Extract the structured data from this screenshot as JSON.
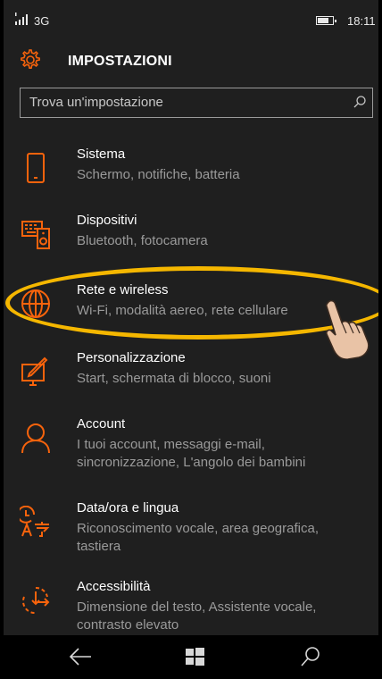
{
  "statusbar": {
    "network": "3G",
    "time": "18:11"
  },
  "header": {
    "title": "IMPOSTAZIONI"
  },
  "search": {
    "placeholder": "Trova un'impostazione"
  },
  "items": [
    {
      "name": "Sistema",
      "desc": "Schermo, notifiche, batteria",
      "icon": "phone-icon"
    },
    {
      "name": "Dispositivi",
      "desc": "Bluetooth, fotocamera",
      "icon": "devices-icon"
    },
    {
      "name": "Rete e wireless",
      "desc": "Wi-Fi, modalità aereo, rete cellulare",
      "icon": "globe-icon"
    },
    {
      "name": "Personalizzazione",
      "desc": "Start, schermata di blocco, suoni",
      "icon": "personalize-icon"
    },
    {
      "name": "Account",
      "desc": "I tuoi account, messaggi e-mail, sincronizzazione, L'angolo dei bambini",
      "icon": "person-icon"
    },
    {
      "name": "Data/ora e lingua",
      "desc": "Riconoscimento vocale, area geografica, tastiera",
      "icon": "time-language-icon"
    },
    {
      "name": "Accessibilità",
      "desc": "Dimensione del testo, Assistente vocale, contrasto elevato",
      "icon": "accessibility-icon"
    }
  ],
  "colors": {
    "accent": "#f7630c",
    "highlight": "#f5b700",
    "background": "#1f1f1f"
  }
}
